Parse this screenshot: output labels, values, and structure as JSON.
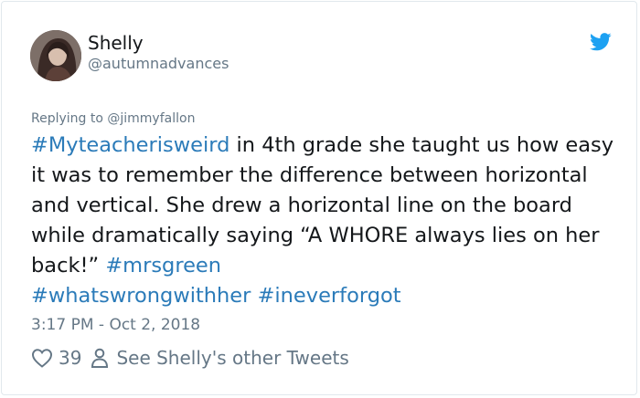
{
  "tweet": {
    "author_name": "Shelly",
    "author_handle": "@autumnadvances",
    "replying_to": "Replying to @jimmyfallon",
    "segments": [
      {
        "type": "hashtag",
        "text": "#Myteacherisweird"
      },
      {
        "type": "text",
        "text": " in 4th grade she taught us how easy it was to remember the difference between horizontal and vertical. She drew a horizontal line on the board while dramatically saying “A WHORE always lies on her back!” "
      },
      {
        "type": "hashtag",
        "text": "#mrsgreen"
      },
      {
        "type": "text",
        "text": " "
      },
      {
        "type": "hashtag",
        "text": "#whatswrongwithher"
      },
      {
        "type": "text",
        "text": " "
      },
      {
        "type": "hashtag",
        "text": "#ineverforgot"
      }
    ],
    "timestamp": "3:17 PM - Oct 2, 2018",
    "like_count": "39",
    "other_tweets_label": "See Shelly's other Tweets"
  },
  "icons": {
    "logo": "twitter-bird-icon",
    "like": "heart-icon",
    "profile": "person-icon"
  },
  "colors": {
    "brand": "#1da1f2",
    "hashtag": "#2b7bb9",
    "secondary_text": "#657786",
    "primary_text": "#14171a",
    "border": "#e1e8ed"
  }
}
